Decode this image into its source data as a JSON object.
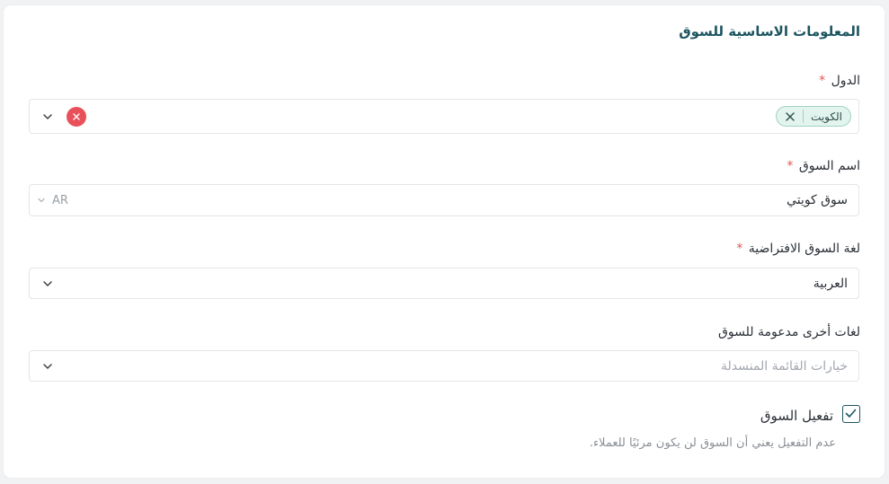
{
  "section": {
    "title": "المعلومات الاساسية للسوق"
  },
  "countries": {
    "label": "الدول",
    "required_mark": "*",
    "selected_tags": [
      "الكويت"
    ],
    "remove_tag_icon": "close-icon",
    "clear_icon": "close-icon",
    "clear_color": "#e8515a",
    "dropdown_icon": "chevron-down-icon"
  },
  "market_name": {
    "label": "اسم السوق",
    "required_mark": "*",
    "value": "سوق كويتي",
    "language_code": "AR",
    "language_icon": "chevron-down-icon"
  },
  "default_language": {
    "label": "لغة السوق الافتراضية",
    "required_mark": "*",
    "value": "العربية",
    "dropdown_icon": "chevron-down-icon"
  },
  "other_languages": {
    "label": "لغات أخرى مدعومة للسوق",
    "placeholder": "خيارات القائمة المنسدلة",
    "dropdown_icon": "chevron-down-icon"
  },
  "activate_market": {
    "label": "تفعيل السوق",
    "checked": true,
    "helper": "عدم التفعيل يعني أن السوق لن يكون مرئيًا للعملاء.",
    "check_icon": "check-icon"
  },
  "colors": {
    "accent": "#1c5561",
    "tag_bg": "#e3f4ef",
    "tag_border": "#9fd3c3",
    "required": "#e25555"
  }
}
